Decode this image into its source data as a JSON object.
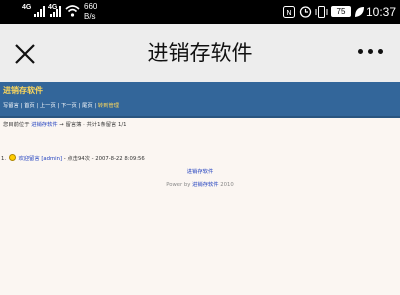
{
  "status_bar": {
    "network_1": "4G",
    "network_2": "4G",
    "speed_value": "660",
    "speed_unit": "B/s",
    "battery": "75",
    "time": "10:37",
    "icons": [
      "signal-icon",
      "wifi-icon",
      "nfc-icon",
      "alarm-icon",
      "vibrate-icon",
      "battery-icon",
      "leaf-icon"
    ]
  },
  "nav": {
    "title": "进销存软件",
    "close_icon": "close-icon",
    "more_icon": "more-icon"
  },
  "site": {
    "title": "进销存软件",
    "menu": [
      "写留言",
      "首页",
      "上一页",
      "下一页",
      "尾页",
      "转到管理"
    ],
    "menu_sep": "|"
  },
  "breadcrumb": {
    "prefix": "您目前位于",
    "site_link": "进销存软件",
    "arrow": "→",
    "section": "留言簿",
    "stats": "· 共计1条留言 1/1"
  },
  "post": {
    "number": "1.",
    "title_link": "欢迎留言",
    "author_link": "[admin]",
    "meta": "- 点击94次 - 2007-8-22 8:09:56"
  },
  "footer": {
    "link": "进销存软件",
    "powered_prefix": "Power by",
    "powered_link": "进销存软件",
    "year": "2010"
  },
  "colors": {
    "header_bg": "#33669a",
    "title_yellow": "#ffd85a",
    "link_blue": "#1f3fbf",
    "page_bg": "#fbf6f2",
    "nav_bg": "#ededed"
  }
}
